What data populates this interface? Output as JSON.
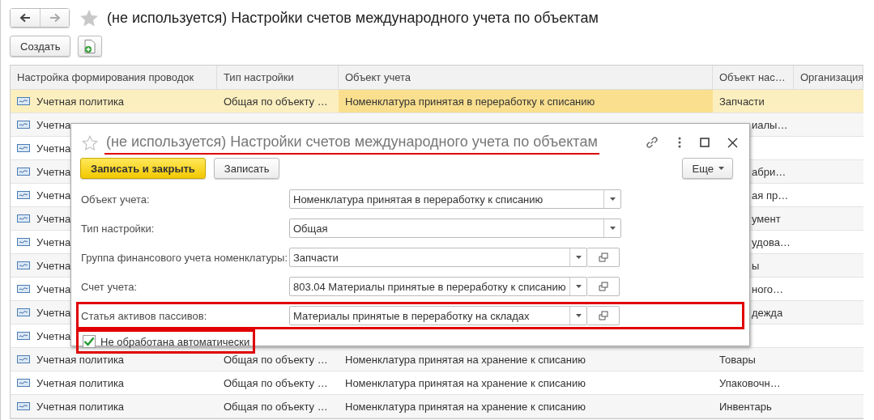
{
  "window": {
    "title": "(не используется) Настройки счетов международного учета по объектам"
  },
  "toolbar": {
    "create_button": "Создать"
  },
  "table": {
    "columns": [
      "Настройка формирования проводок",
      "Тип настройки",
      "Объект учета",
      "Объект нас…",
      "Организация"
    ],
    "rows": [
      {
        "kind": "full",
        "selected": true,
        "cells": [
          "Учетная политика",
          "Общая по объекту …",
          "Номенклатура принятая в переработку к списанию",
          "Запчасти",
          ""
        ]
      },
      {
        "kind": "covered",
        "selected": false,
        "cells": [
          "Учетна",
          "иалы…"
        ]
      },
      {
        "kind": "covered",
        "selected": false,
        "cells": [
          "Учетна",
          ""
        ]
      },
      {
        "kind": "covered",
        "selected": false,
        "cells": [
          "Учетна",
          "абри…"
        ]
      },
      {
        "kind": "covered",
        "selected": false,
        "cells": [
          "Учетна",
          "ая пр…"
        ]
      },
      {
        "kind": "covered",
        "selected": false,
        "cells": [
          "Учетна",
          "умент"
        ]
      },
      {
        "kind": "covered",
        "selected": false,
        "cells": [
          "Учетна",
          "удова…"
        ]
      },
      {
        "kind": "covered",
        "selected": false,
        "cells": [
          "Учетна",
          "ы"
        ]
      },
      {
        "kind": "covered",
        "selected": false,
        "cells": [
          "Учетна",
          "ного…"
        ]
      },
      {
        "kind": "covered",
        "selected": false,
        "cells": [
          "Учетна",
          "дежда"
        ]
      },
      {
        "kind": "covered",
        "selected": false,
        "cells": [
          "Учетна",
          ""
        ]
      },
      {
        "kind": "full",
        "selected": false,
        "cells": [
          "Учетная политика",
          "Общая по объекту …",
          "Номенклатура принятая на хранение к списанию",
          "Товары",
          ""
        ]
      },
      {
        "kind": "full",
        "selected": false,
        "cells": [
          "Учетная политика",
          "Общая по объекту …",
          "Номенклатура принятая на хранение к списанию",
          "Упаковочн…",
          ""
        ]
      },
      {
        "kind": "full",
        "selected": false,
        "cells": [
          "Учетная политика",
          "Общая по объекту …",
          "Номенклатура принятая на хранение к списанию",
          "Инвентарь",
          ""
        ]
      }
    ]
  },
  "dialog": {
    "title": "(не используется) Настройки счетов международного учета по объектам",
    "title_underlined": true,
    "buttons": [
      {
        "label": "Записать и закрыть",
        "kind": "default"
      },
      {
        "label": "Записать",
        "kind": "plain"
      }
    ],
    "more_button": "Еще",
    "fields": [
      {
        "label": "Объект учета:",
        "value": "Номенклатура принятая в переработку к списанию",
        "open_button": false,
        "highlighted": false
      },
      {
        "label": "Тип настройки:",
        "value": "Общая",
        "open_button": false,
        "highlighted": false
      },
      {
        "label": "Группа финансового учета номенклатуры:",
        "value": "Запчасти",
        "open_button": true,
        "highlighted": false
      },
      {
        "label": "Счет учета:",
        "value": "803.04 Материалы принятые в переработку к списанию",
        "open_button": true,
        "highlighted": false
      },
      {
        "label": "Статья активов пассивов:",
        "value": "Материалы принятые в переработку на складах",
        "open_button": true,
        "highlighted": true
      }
    ],
    "checkbox": {
      "label": "Не обработана автоматически",
      "checked": true,
      "highlighted": true
    }
  }
}
